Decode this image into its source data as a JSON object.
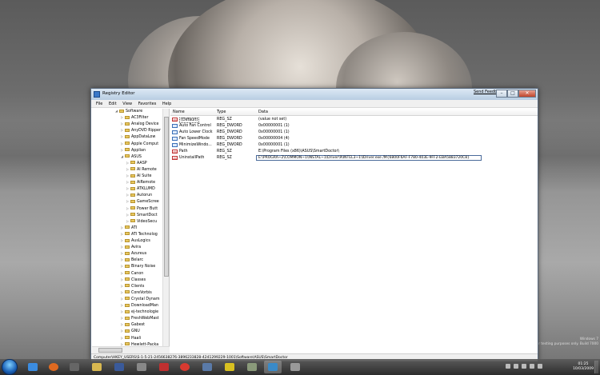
{
  "window": {
    "title": "Registry Editor",
    "feedback_link": "Send Feedback",
    "min": "–",
    "max": "□",
    "close": "✕"
  },
  "menu": [
    "File",
    "Edit",
    "View",
    "Favorites",
    "Help"
  ],
  "tree": {
    "items": [
      {
        "label": "Software",
        "level": 0,
        "expanded": true
      },
      {
        "label": "AC3Filter",
        "level": 1,
        "expanded": false
      },
      {
        "label": "Analog Device",
        "level": 1,
        "expanded": false
      },
      {
        "label": "AnyDVD Ripper",
        "level": 1,
        "expanded": false
      },
      {
        "label": "AppDataLow",
        "level": 1,
        "expanded": false
      },
      {
        "label": "Apple Comput",
        "level": 1,
        "expanded": false
      },
      {
        "label": "Applian",
        "level": 1,
        "expanded": false
      },
      {
        "label": "ASUS",
        "level": 1,
        "expanded": true
      },
      {
        "label": "AASP",
        "level": 2,
        "expanded": false
      },
      {
        "label": "AI Remote",
        "level": 2,
        "expanded": false
      },
      {
        "label": "AI Suite",
        "level": 2,
        "expanded": false
      },
      {
        "label": "AiRemote",
        "level": 2,
        "expanded": false
      },
      {
        "label": "ATKLUMD",
        "level": 2,
        "expanded": false
      },
      {
        "label": "Autorun",
        "level": 2,
        "expanded": false
      },
      {
        "label": "GameScree",
        "level": 2,
        "expanded": false
      },
      {
        "label": "Power Butt",
        "level": 2,
        "expanded": false
      },
      {
        "label": "SmartDoct",
        "level": 2,
        "expanded": false
      },
      {
        "label": "VideoSecu",
        "level": 2,
        "expanded": false
      },
      {
        "label": "ATI",
        "level": 1,
        "expanded": false
      },
      {
        "label": "ATI Technolog",
        "level": 1,
        "expanded": false
      },
      {
        "label": "AusLogics",
        "level": 1,
        "expanded": false
      },
      {
        "label": "Avira",
        "level": 1,
        "expanded": false
      },
      {
        "label": "Azureus",
        "level": 1,
        "expanded": false
      },
      {
        "label": "Belarc",
        "level": 1,
        "expanded": false
      },
      {
        "label": "Binary Noise",
        "level": 1,
        "expanded": false
      },
      {
        "label": "Canon",
        "level": 1,
        "expanded": false
      },
      {
        "label": "Classes",
        "level": 1,
        "expanded": false
      },
      {
        "label": "Clients",
        "level": 1,
        "expanded": false
      },
      {
        "label": "CoreVorbis",
        "level": 1,
        "expanded": false
      },
      {
        "label": "Crystal Dynam",
        "level": 1,
        "expanded": false
      },
      {
        "label": "DownloadMan",
        "level": 1,
        "expanded": false
      },
      {
        "label": "ej-technologie",
        "level": 1,
        "expanded": false
      },
      {
        "label": "FreshWebMast",
        "level": 1,
        "expanded": false
      },
      {
        "label": "Gabest",
        "level": 1,
        "expanded": false
      },
      {
        "label": "GNU",
        "level": 1,
        "expanded": false
      },
      {
        "label": "Haali",
        "level": 1,
        "expanded": false
      },
      {
        "label": "Hewlett-Packa",
        "level": 1,
        "expanded": false
      }
    ]
  },
  "list": {
    "headers": {
      "name": "Name",
      "type": "Type",
      "data": "Data"
    },
    "rows": [
      {
        "name": "(Default)",
        "type": "REG_SZ",
        "data": "(value not set)",
        "kind": "string"
      },
      {
        "name": "Auto Fan Control",
        "type": "REG_DWORD",
        "data": "0x00000001 (1)",
        "kind": "binary"
      },
      {
        "name": "Auto Lower Clock",
        "type": "REG_DWORD",
        "data": "0x00000001 (1)",
        "kind": "binary"
      },
      {
        "name": "Fan SpeedMode",
        "type": "REG_DWORD",
        "data": "0x00000004 (4)",
        "kind": "binary"
      },
      {
        "name": "MinimizeWindo...",
        "type": "REG_DWORD",
        "data": "0x00000001 (1)",
        "kind": "binary"
      },
      {
        "name": "Path",
        "type": "REG_SZ",
        "data": "E:\\Program Files (x86)\\ASUS\\SmartDoctor\\",
        "kind": "string"
      },
      {
        "name": "UninstallPath",
        "type": "REG_SZ",
        "data": "E:\\PROGRA~2\\COMMON~1\\INSTAL~1\\Driver\\9\\INTEL3~1\\IDriver.exe /M{6800F6AF-F780-403E-9FF2-EBA5883720C8}",
        "kind": "string"
      }
    ]
  },
  "status": "Computer\\HKEY_USERS\\S-1-5-21-2456638276-3896233828-4241299229-1001\\Software\\ASUS\\SmartDoctor",
  "watermark": {
    "line1": "Windows 7",
    "line2": "For testing purposes only. Build 7000"
  },
  "clock": {
    "time": "01:25",
    "date": "10/03/2009"
  }
}
